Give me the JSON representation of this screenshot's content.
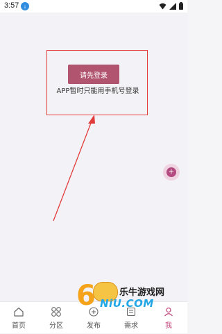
{
  "status_bar": {
    "time": "3:57",
    "notification_glyph": "↓",
    "icons": [
      "wifi-icon",
      "signal-icon",
      "battery-icon"
    ]
  },
  "login": {
    "button_label": "请先登录",
    "hint": "APP暂时只能用手机号登录"
  },
  "floating_action": {
    "glyph": "+"
  },
  "tabs": [
    {
      "label": "首页",
      "icon": "home-icon"
    },
    {
      "label": "分区",
      "icon": "category-icon"
    },
    {
      "label": "发布",
      "icon": "publish-icon"
    },
    {
      "label": "需求",
      "icon": "demand-icon"
    },
    {
      "label": "我",
      "icon": "profile-icon",
      "active": true
    }
  ],
  "watermark": {
    "digit": "6",
    "name": "乐牛游戏网",
    "domain": "NiU.COM"
  },
  "colors": {
    "accent": "#b1546f",
    "highlight": "#e23b3b",
    "active_tab": "#c2437a",
    "floating": "#b34a80"
  }
}
